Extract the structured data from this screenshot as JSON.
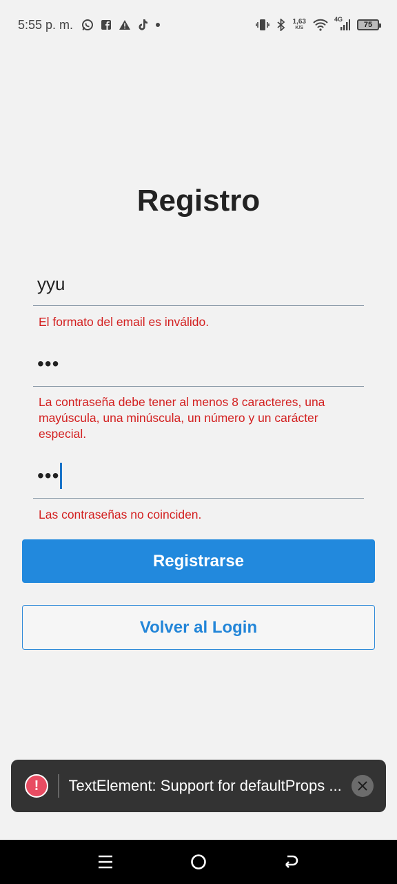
{
  "status_bar": {
    "time": "5:55 p. m.",
    "speed_value": "1,63",
    "speed_unit": "K/S",
    "network": "4G",
    "battery": "75"
  },
  "form": {
    "title": "Registro",
    "email_value": "yyu",
    "email_error": "El formato del email es inválido.",
    "password_value": "•••",
    "password_error": "La contraseña debe tener al menos 8 caracteres, una mayúscula, una minúscula, un número y un carácter especial.",
    "confirm_value": "•••",
    "confirm_error": "Las contraseñas no coinciden.",
    "register_label": "Registrarse",
    "back_label": "Volver al Login"
  },
  "toast": {
    "message": "TextElement: Support for defaultProps ..."
  },
  "colors": {
    "primary": "#2289dd",
    "error": "#d32020",
    "background": "#f2f2f2"
  }
}
